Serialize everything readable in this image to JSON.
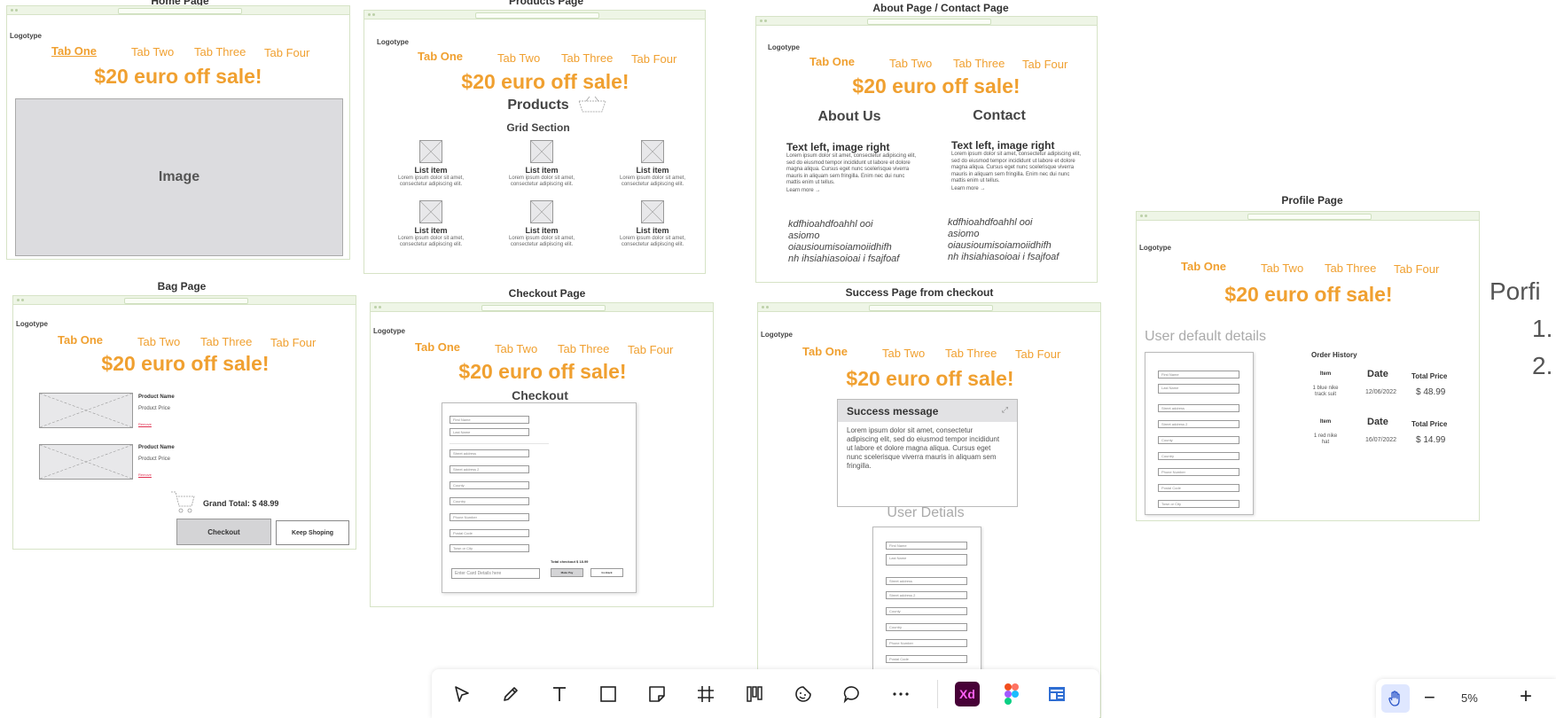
{
  "boards": {
    "home": {
      "title": "Home Page",
      "image_label": "Image"
    },
    "products": {
      "title": "Products Page",
      "products_heading": "Products",
      "grid_heading": "Grid Section",
      "items": [
        {
          "title": "List item",
          "desc": "Lorem ipsum dolor sit amet, consectetur adipiscing elit."
        },
        {
          "title": "List item",
          "desc": "Lorem ipsum dolor sit amet, consectetur adipiscing elit."
        },
        {
          "title": "List item",
          "desc": "Lorem ipsum dolor sit amet, consectetur adipiscing elit."
        },
        {
          "title": "List item",
          "desc": "Lorem ipsum dolor sit amet, consectetur adipiscing elit."
        },
        {
          "title": "List item",
          "desc": "Lorem ipsum dolor sit amet, consectetur adipiscing elit."
        },
        {
          "title": "List item",
          "desc": "Lorem ipsum dolor sit amet, consectetur adipiscing elit."
        }
      ]
    },
    "about": {
      "title": "About Page / Contact Page",
      "about_heading": "About Us",
      "contact_heading": "Contact",
      "block_title": "Text left, image right",
      "block_body": "Lorem ipsum dolor sit amet, consectetur adipiscing elit, sed do eiusmod tempor incididunt ut labore et dolore magna aliqua. Cursus eget nunc scelerisque viverra mauris in aliquam sem fringilla. Enim nec dui nunc mattis enim ut tellus.",
      "learn_more": "Learn more →",
      "scribble": [
        "kdfhioahdfoahhl ooi",
        "asiomo",
        "oiausioumisoiamoiidhifh",
        "nh ihsiahiasoioai i fsajfoaf"
      ]
    },
    "profile": {
      "title": "Profile Page",
      "user_heading": "User default details",
      "order_history_title": "Order History",
      "orders": [
        {
          "item_label": "Item",
          "date_label": "Date",
          "total_label": "Total Price",
          "item": "1 blue nike track suit",
          "date": "12/06/2022",
          "total": "$ 48.99"
        },
        {
          "item_label": "Item",
          "date_label": "Date",
          "total_label": "Total Price",
          "item": "1 red nike hat",
          "date": "16/07/2022",
          "total": "$ 14.99"
        }
      ],
      "fields": [
        "First Name",
        "Last Name",
        "Street address",
        "Street address 2",
        "County",
        "Country",
        "Phone Number",
        "Postal Code",
        "Town or City"
      ]
    },
    "bag": {
      "title": "Bag Page",
      "product_name": "Product Name",
      "product_price": "Product Price",
      "remove": "Remove",
      "grand_total": "Grand Total: $ 48.99",
      "checkout_btn": "Checkout",
      "keep_btn": "Keep Shoping"
    },
    "checkout": {
      "title": "Checkout Page",
      "heading": "Checkout",
      "fields": [
        "First Name",
        "Last Name",
        "Street address",
        "Street address 2",
        "County",
        "Country",
        "Phone Number",
        "Postal Code",
        "Town or City"
      ],
      "card_placeholder": "Enter Card Details here",
      "total_text": "Total checkout $ 18.99",
      "make_pay": "Make Pay",
      "go_back": "Go Back"
    },
    "success": {
      "title": "Success Page from checkout",
      "message_title": "Success message",
      "message_body": "Lorem ipsum dolor sit amet, consectetur adipiscing elit, sed do eiusmod tempor incididunt ut labore et dolore magna aliqua. Cursus eget nunc scelerisque viverra mauris in aliquam sem fringilla.",
      "user_heading": "User Detials",
      "fields": [
        "First Name",
        "Last Name",
        "Street address",
        "Street address 2",
        "County",
        "Country",
        "Phone Number",
        "Postal Code"
      ]
    }
  },
  "common": {
    "logo": "Logotype",
    "tabs": [
      "Tab One",
      "Tab Two",
      "Tab Three",
      "Tab Four"
    ],
    "sale": "$20 euro off sale!"
  },
  "side_notes": {
    "title": "Porfi",
    "line1": "1.",
    "line2": "2."
  },
  "toolbar": {
    "tools": [
      "select-tool",
      "pen-tool",
      "text-tool",
      "rectangle-tool",
      "sticky-note-tool",
      "frame-tool",
      "columns-tool",
      "sticker-tool",
      "comment-tool",
      "more-tool",
      "adobe-xd-app",
      "figma-app",
      "wireframe-app"
    ],
    "xd_label": "Xd"
  },
  "zoom": {
    "level": "5%",
    "minus": "−",
    "plus": "+"
  },
  "colors": {
    "accent": "#f0a030",
    "frame_border": "#d6e3c6",
    "xd_bg": "#470137",
    "xd_fg": "#ff61f6",
    "wire_blue": "#2f6ed3"
  }
}
